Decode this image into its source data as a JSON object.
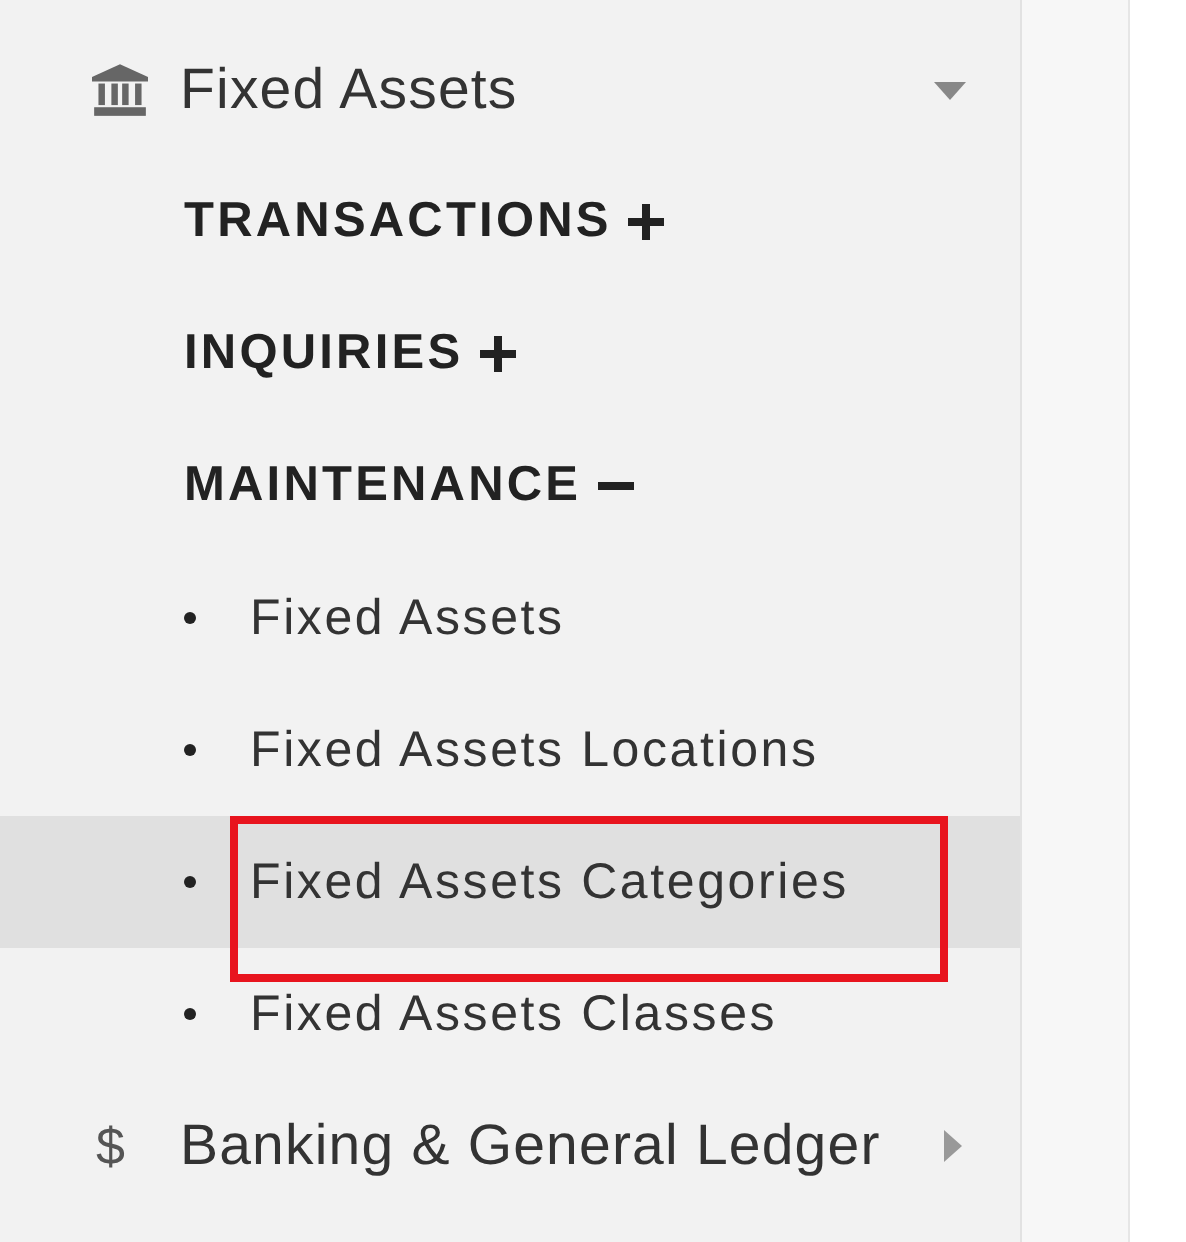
{
  "modules": [
    {
      "label": "Fixed Assets",
      "kind": "bank",
      "expanded": true,
      "sections": [
        {
          "label": "TRANSACTIONS",
          "expanded": false
        },
        {
          "label": "INQUIRIES",
          "expanded": false
        },
        {
          "label": "MAINTENANCE",
          "expanded": true,
          "items": [
            {
              "label": "Fixed Assets",
              "selected": false,
              "annotated": false
            },
            {
              "label": "Fixed Assets Locations",
              "selected": false,
              "annotated": false
            },
            {
              "label": "Fixed Assets Categories",
              "selected": true,
              "annotated": true
            },
            {
              "label": "Fixed Assets Classes",
              "selected": false,
              "annotated": false
            }
          ]
        }
      ]
    },
    {
      "label": "Banking & General Ledger",
      "kind": "glyph",
      "icon_text": "$",
      "expanded": false
    }
  ]
}
